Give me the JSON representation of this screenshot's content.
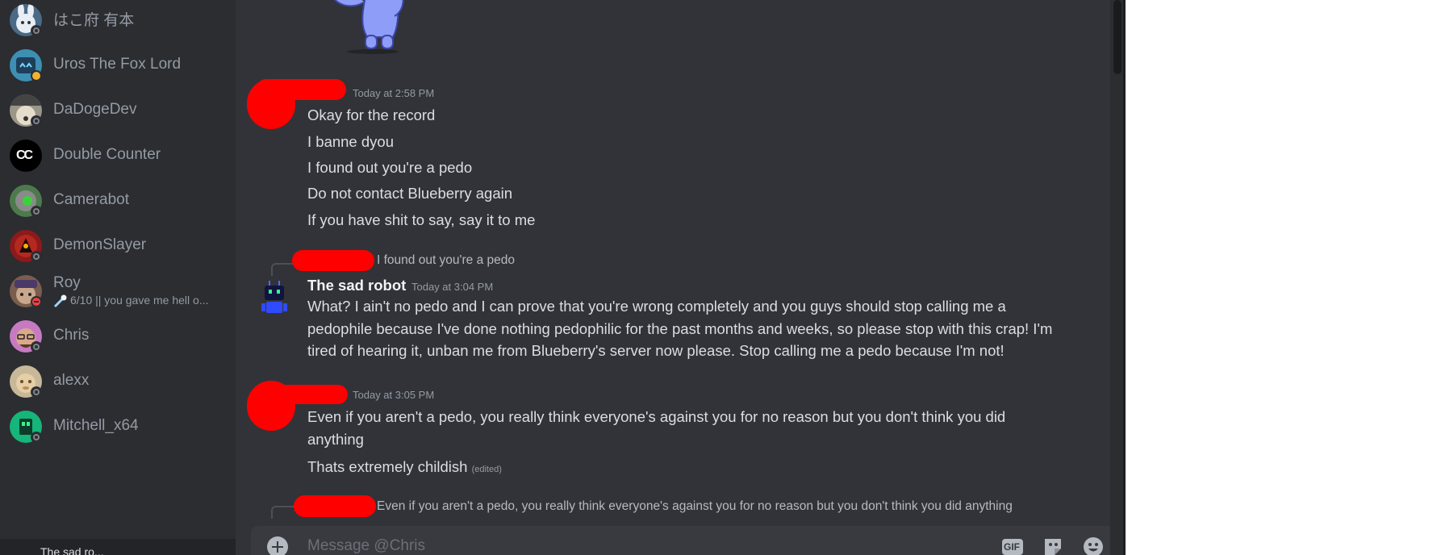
{
  "dm_list": [
    {
      "name": "はこ府 有本",
      "status": "offline",
      "avatar_color": "#4a6a86"
    },
    {
      "name": "Uros The Fox Lord",
      "status": "idle",
      "avatar_color": "#3d8fb3"
    },
    {
      "name": "DaDogeDev",
      "status": "offline",
      "avatar_color": "#9a9688"
    },
    {
      "name": "Double Counter",
      "status": "none",
      "avatar_color": "#000000",
      "avatar_text": "CC"
    },
    {
      "name": "Camerabot",
      "status": "offline",
      "avatar_color": "#4d7a4d"
    },
    {
      "name": "DemonSlayer",
      "status": "offline",
      "avatar_color": "#8c1a1a"
    },
    {
      "name": "Roy",
      "status": "dnd",
      "avatar_color": "#7a5d4e",
      "activity": "6/10 || you gave me hell o..."
    },
    {
      "name": "Chris",
      "status": "offline",
      "avatar_color": "#c77ac2"
    },
    {
      "name": "alexx",
      "status": "offline",
      "avatar_color": "#c8b89a"
    },
    {
      "name": "Mitchell_x64",
      "status": "offline",
      "avatar_color": "#16b57a"
    }
  ],
  "user_panel": {
    "name": "The sad ro..."
  },
  "messages": {
    "group1": {
      "timestamp": "Today at 2:58 PM",
      "lines": [
        "Okay for the record",
        "I banne dyou",
        "I found out you're a pedo",
        "Do not contact Blueberry again",
        "If you have shit to say, say it to me"
      ]
    },
    "group2": {
      "reply_text": "I found out you're a pedo",
      "author": "The sad robot",
      "timestamp": "Today at 3:04 PM",
      "text": "What? I ain't no pedo and I can prove that you're wrong completely and you guys should stop calling me a pedophile because I've done nothing pedophilic for the past months and weeks, so please stop with this crap! I'm tired of hearing it, unban me from Blueberry's server now please. Stop calling me a pedo because I'm not!"
    },
    "group3": {
      "timestamp": "Today at 3:05 PM",
      "line1": "Even if you aren't a pedo, you really think everyone's against you for no reason but you don't think you did anything",
      "line2": "Thats extremely childish",
      "edited": "(edited)"
    },
    "group4": {
      "reply_text": "Even if you aren't a pedo, you really think everyone's against you for no reason but you don't think you did anything"
    }
  },
  "composer": {
    "placeholder": "Message @Chris",
    "gif_label": "GIF"
  },
  "colors": {
    "redaction": "#ff0000",
    "accent": "#5865f2"
  }
}
